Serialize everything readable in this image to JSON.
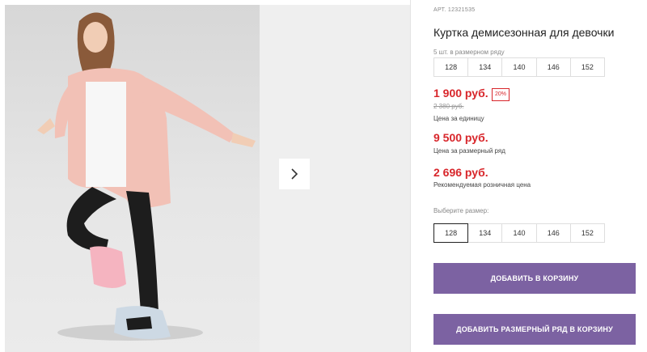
{
  "product": {
    "article": "АРТ. 12321535",
    "title": "Куртка демисезонная для девочки"
  },
  "size_range": {
    "label": "5 шт. в размерном ряду",
    "sizes": [
      "128",
      "134",
      "140",
      "146",
      "152"
    ]
  },
  "pricing": {
    "unit_price": "1 900 руб.",
    "discount_badge": "20%",
    "old_price": "2 380 руб.",
    "unit_price_note": "Цена за единицу",
    "range_price": "9 500 руб.",
    "range_price_note": "Цена за размерный ряд",
    "retail_price": "2 696 руб.",
    "retail_price_note": "Рекомендуемая розничная цена",
    "accent_color": "#d8262b"
  },
  "size_select": {
    "label": "Выберите размер:",
    "options": [
      "128",
      "134",
      "140",
      "146",
      "152"
    ],
    "selected": "128"
  },
  "actions": {
    "add_to_cart": "ДОБАВИТЬ В КОРЗИНУ",
    "add_range_to_cart": "ДОБАВИТЬ РАЗМЕРНЫЙ РЯД В КОРЗИНУ",
    "button_color": "#7c62a2"
  },
  "gallery": {
    "next_icon": "chevron-right-icon"
  }
}
